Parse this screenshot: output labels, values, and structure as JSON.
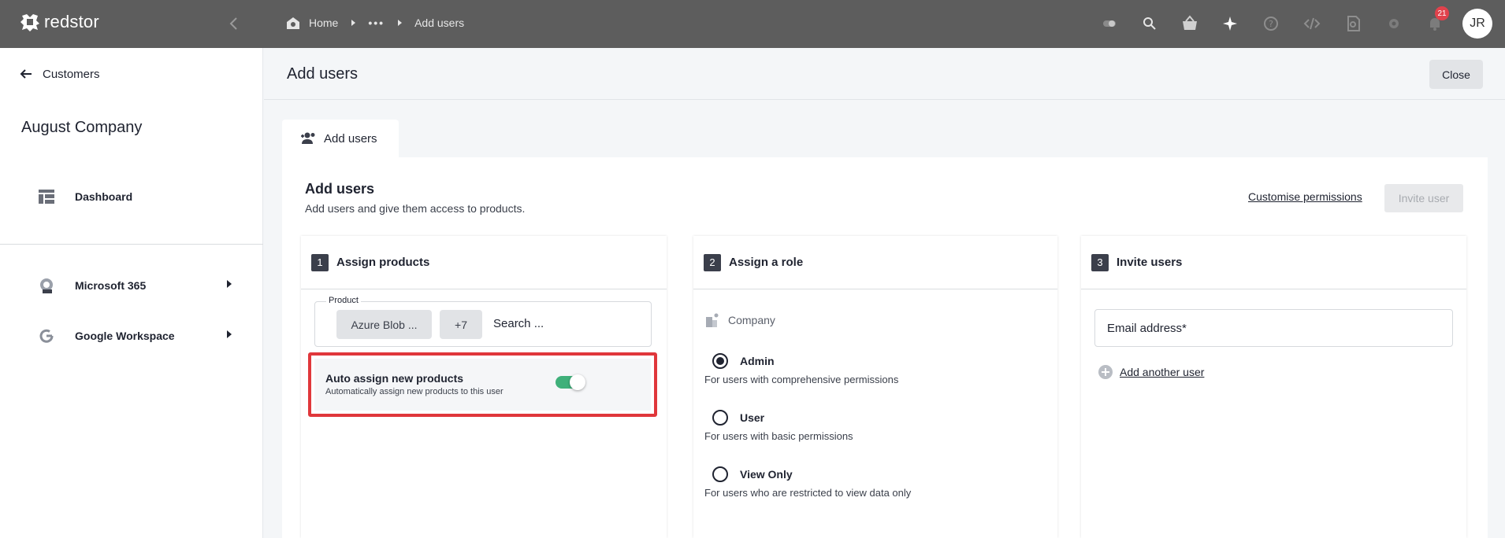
{
  "app": {
    "brand": "redstor"
  },
  "breadcrumb": {
    "home": "Home",
    "more": "•••",
    "current": "Add users"
  },
  "notifications": {
    "count": "21"
  },
  "user": {
    "initials": "JR"
  },
  "sidebar": {
    "back_label": "Customers",
    "org_name": "August Company",
    "dashboard": "Dashboard",
    "items": [
      {
        "label": "Microsoft 365",
        "icon": "m365-icon"
      },
      {
        "label": "Google Workspace",
        "icon": "google-icon"
      }
    ]
  },
  "page": {
    "title": "Add users",
    "close": "Close"
  },
  "tab": {
    "label": "Add users"
  },
  "card": {
    "title": "Add users",
    "subtitle": "Add users and give them access to products.",
    "customise_link": "Customise permissions",
    "invite_button": "Invite user"
  },
  "step1": {
    "number": "1",
    "title": "Assign products",
    "product_label": "Product",
    "chip_product": "Azure Blob ...",
    "chip_more": "+7",
    "search": "Search ...",
    "auto_title": "Auto assign new products",
    "auto_sub": "Automatically assign new products to this user",
    "auto_enabled": true
  },
  "step2": {
    "number": "2",
    "title": "Assign a role",
    "scope": "Company",
    "roles": [
      {
        "label": "Admin",
        "desc": "For users with comprehensive permissions",
        "selected": true
      },
      {
        "label": "User",
        "desc": "For users with basic permissions",
        "selected": false
      },
      {
        "label": "View Only",
        "desc": "For users who are restricted to view data only",
        "selected": false
      }
    ]
  },
  "step3": {
    "number": "3",
    "title": "Invite users",
    "email_placeholder": "Email address*",
    "add_another": "Add another user"
  },
  "colors": {
    "topbar": "#5d5d5d",
    "accent_green": "#3fb07a",
    "highlight_red": "#e0373b",
    "badge_red": "#e0424c"
  }
}
